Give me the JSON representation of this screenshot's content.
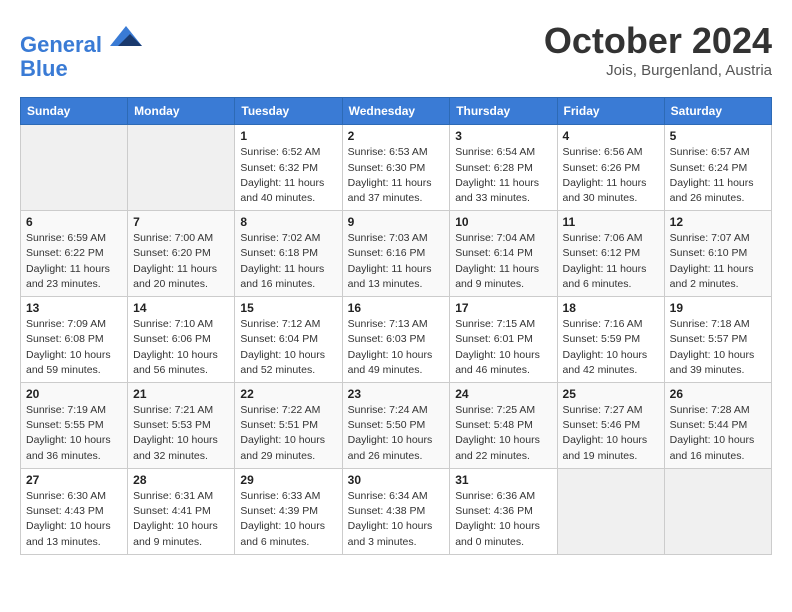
{
  "header": {
    "logo_line1": "General",
    "logo_line2": "Blue",
    "month": "October 2024",
    "location": "Jois, Burgenland, Austria"
  },
  "weekdays": [
    "Sunday",
    "Monday",
    "Tuesday",
    "Wednesday",
    "Thursday",
    "Friday",
    "Saturday"
  ],
  "weeks": [
    [
      {
        "day": "",
        "info": ""
      },
      {
        "day": "",
        "info": ""
      },
      {
        "day": "1",
        "info": "Sunrise: 6:52 AM\nSunset: 6:32 PM\nDaylight: 11 hours and 40 minutes."
      },
      {
        "day": "2",
        "info": "Sunrise: 6:53 AM\nSunset: 6:30 PM\nDaylight: 11 hours and 37 minutes."
      },
      {
        "day": "3",
        "info": "Sunrise: 6:54 AM\nSunset: 6:28 PM\nDaylight: 11 hours and 33 minutes."
      },
      {
        "day": "4",
        "info": "Sunrise: 6:56 AM\nSunset: 6:26 PM\nDaylight: 11 hours and 30 minutes."
      },
      {
        "day": "5",
        "info": "Sunrise: 6:57 AM\nSunset: 6:24 PM\nDaylight: 11 hours and 26 minutes."
      }
    ],
    [
      {
        "day": "6",
        "info": "Sunrise: 6:59 AM\nSunset: 6:22 PM\nDaylight: 11 hours and 23 minutes."
      },
      {
        "day": "7",
        "info": "Sunrise: 7:00 AM\nSunset: 6:20 PM\nDaylight: 11 hours and 20 minutes."
      },
      {
        "day": "8",
        "info": "Sunrise: 7:02 AM\nSunset: 6:18 PM\nDaylight: 11 hours and 16 minutes."
      },
      {
        "day": "9",
        "info": "Sunrise: 7:03 AM\nSunset: 6:16 PM\nDaylight: 11 hours and 13 minutes."
      },
      {
        "day": "10",
        "info": "Sunrise: 7:04 AM\nSunset: 6:14 PM\nDaylight: 11 hours and 9 minutes."
      },
      {
        "day": "11",
        "info": "Sunrise: 7:06 AM\nSunset: 6:12 PM\nDaylight: 11 hours and 6 minutes."
      },
      {
        "day": "12",
        "info": "Sunrise: 7:07 AM\nSunset: 6:10 PM\nDaylight: 11 hours and 2 minutes."
      }
    ],
    [
      {
        "day": "13",
        "info": "Sunrise: 7:09 AM\nSunset: 6:08 PM\nDaylight: 10 hours and 59 minutes."
      },
      {
        "day": "14",
        "info": "Sunrise: 7:10 AM\nSunset: 6:06 PM\nDaylight: 10 hours and 56 minutes."
      },
      {
        "day": "15",
        "info": "Sunrise: 7:12 AM\nSunset: 6:04 PM\nDaylight: 10 hours and 52 minutes."
      },
      {
        "day": "16",
        "info": "Sunrise: 7:13 AM\nSunset: 6:03 PM\nDaylight: 10 hours and 49 minutes."
      },
      {
        "day": "17",
        "info": "Sunrise: 7:15 AM\nSunset: 6:01 PM\nDaylight: 10 hours and 46 minutes."
      },
      {
        "day": "18",
        "info": "Sunrise: 7:16 AM\nSunset: 5:59 PM\nDaylight: 10 hours and 42 minutes."
      },
      {
        "day": "19",
        "info": "Sunrise: 7:18 AM\nSunset: 5:57 PM\nDaylight: 10 hours and 39 minutes."
      }
    ],
    [
      {
        "day": "20",
        "info": "Sunrise: 7:19 AM\nSunset: 5:55 PM\nDaylight: 10 hours and 36 minutes."
      },
      {
        "day": "21",
        "info": "Sunrise: 7:21 AM\nSunset: 5:53 PM\nDaylight: 10 hours and 32 minutes."
      },
      {
        "day": "22",
        "info": "Sunrise: 7:22 AM\nSunset: 5:51 PM\nDaylight: 10 hours and 29 minutes."
      },
      {
        "day": "23",
        "info": "Sunrise: 7:24 AM\nSunset: 5:50 PM\nDaylight: 10 hours and 26 minutes."
      },
      {
        "day": "24",
        "info": "Sunrise: 7:25 AM\nSunset: 5:48 PM\nDaylight: 10 hours and 22 minutes."
      },
      {
        "day": "25",
        "info": "Sunrise: 7:27 AM\nSunset: 5:46 PM\nDaylight: 10 hours and 19 minutes."
      },
      {
        "day": "26",
        "info": "Sunrise: 7:28 AM\nSunset: 5:44 PM\nDaylight: 10 hours and 16 minutes."
      }
    ],
    [
      {
        "day": "27",
        "info": "Sunrise: 6:30 AM\nSunset: 4:43 PM\nDaylight: 10 hours and 13 minutes."
      },
      {
        "day": "28",
        "info": "Sunrise: 6:31 AM\nSunset: 4:41 PM\nDaylight: 10 hours and 9 minutes."
      },
      {
        "day": "29",
        "info": "Sunrise: 6:33 AM\nSunset: 4:39 PM\nDaylight: 10 hours and 6 minutes."
      },
      {
        "day": "30",
        "info": "Sunrise: 6:34 AM\nSunset: 4:38 PM\nDaylight: 10 hours and 3 minutes."
      },
      {
        "day": "31",
        "info": "Sunrise: 6:36 AM\nSunset: 4:36 PM\nDaylight: 10 hours and 0 minutes."
      },
      {
        "day": "",
        "info": ""
      },
      {
        "day": "",
        "info": ""
      }
    ]
  ]
}
